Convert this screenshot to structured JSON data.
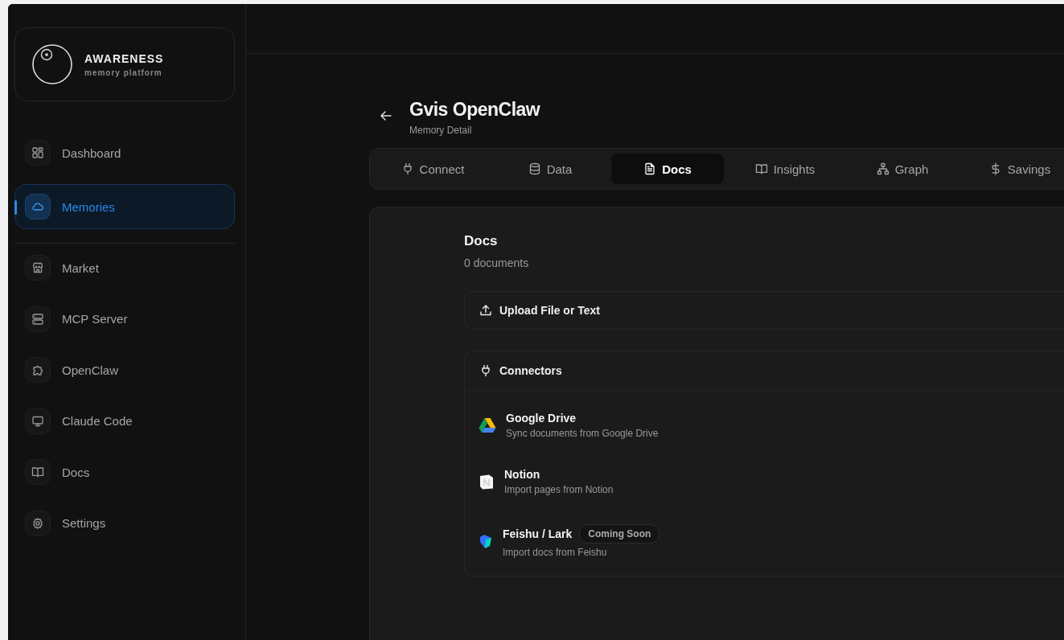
{
  "brand": {
    "name": "AWARENESS",
    "tagline": "memory platform"
  },
  "sidebar": {
    "primary": [
      {
        "label": "Dashboard",
        "selected": false
      },
      {
        "label": "Memories",
        "selected": true
      }
    ],
    "secondary": [
      {
        "label": "Market",
        "selected": false
      },
      {
        "label": "MCP Server",
        "selected": false
      },
      {
        "label": "OpenClaw",
        "selected": false
      },
      {
        "label": "Claude Code",
        "selected": false
      },
      {
        "label": "Docs",
        "selected": false
      },
      {
        "label": "Settings",
        "selected": false
      }
    ]
  },
  "header": {
    "title": "Gvis OpenClaw",
    "subtitle": "Memory Detail"
  },
  "tabs": [
    {
      "label": "Connect",
      "selected": false
    },
    {
      "label": "Data",
      "selected": false
    },
    {
      "label": "Docs",
      "selected": true
    },
    {
      "label": "Insights",
      "selected": false
    },
    {
      "label": "Graph",
      "selected": false
    },
    {
      "label": "Savings",
      "selected": false
    }
  ],
  "docs": {
    "title": "Docs",
    "count": "0 documents",
    "upload": "Upload File or Text",
    "connectors_title": "Connectors",
    "connectors": [
      {
        "name": "Google Drive",
        "description": "Sync documents from Google Drive"
      },
      {
        "name": "Notion",
        "description": "Import pages from Notion"
      },
      {
        "name": "Feishu / Lark",
        "description": "Import docs from Feishu",
        "badge": "Coming Soon"
      }
    ]
  }
}
